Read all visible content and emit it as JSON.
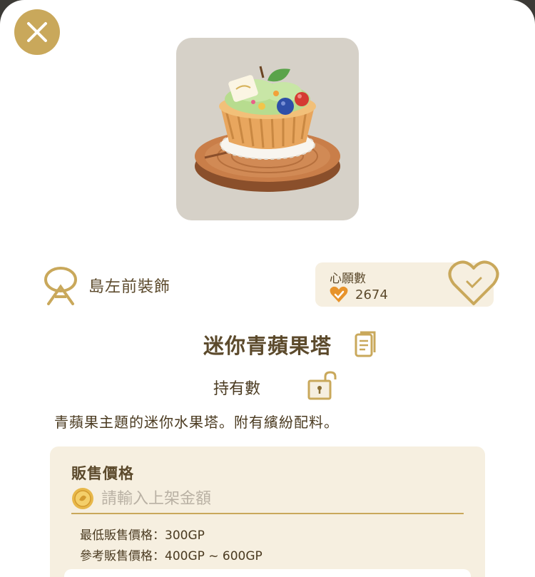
{
  "item": {
    "category": "島左前裝飾",
    "name": "迷你青蘋果塔",
    "description": "青蘋果主題的迷你水果塔。附有繽紛配料。"
  },
  "wishlist": {
    "title": "心願數",
    "count": "2674"
  },
  "ownership": {
    "label": "持有數"
  },
  "price": {
    "title": "販售價格",
    "input_placeholder": "請輸入上架金額",
    "min_price": "最低販售價格：300GP",
    "reference_price": "參考販售價格：400GP ~ 600GP"
  },
  "colors": {
    "accent_gold": "#c9a85b",
    "text_brown": "#5c4a2c",
    "panel_cream": "#f6efe0",
    "wish_orange": "#e7932b"
  },
  "icons": [
    "close-icon",
    "category-icon",
    "heart-icon",
    "detail-icon",
    "lock-icon",
    "gp-coin-icon"
  ]
}
